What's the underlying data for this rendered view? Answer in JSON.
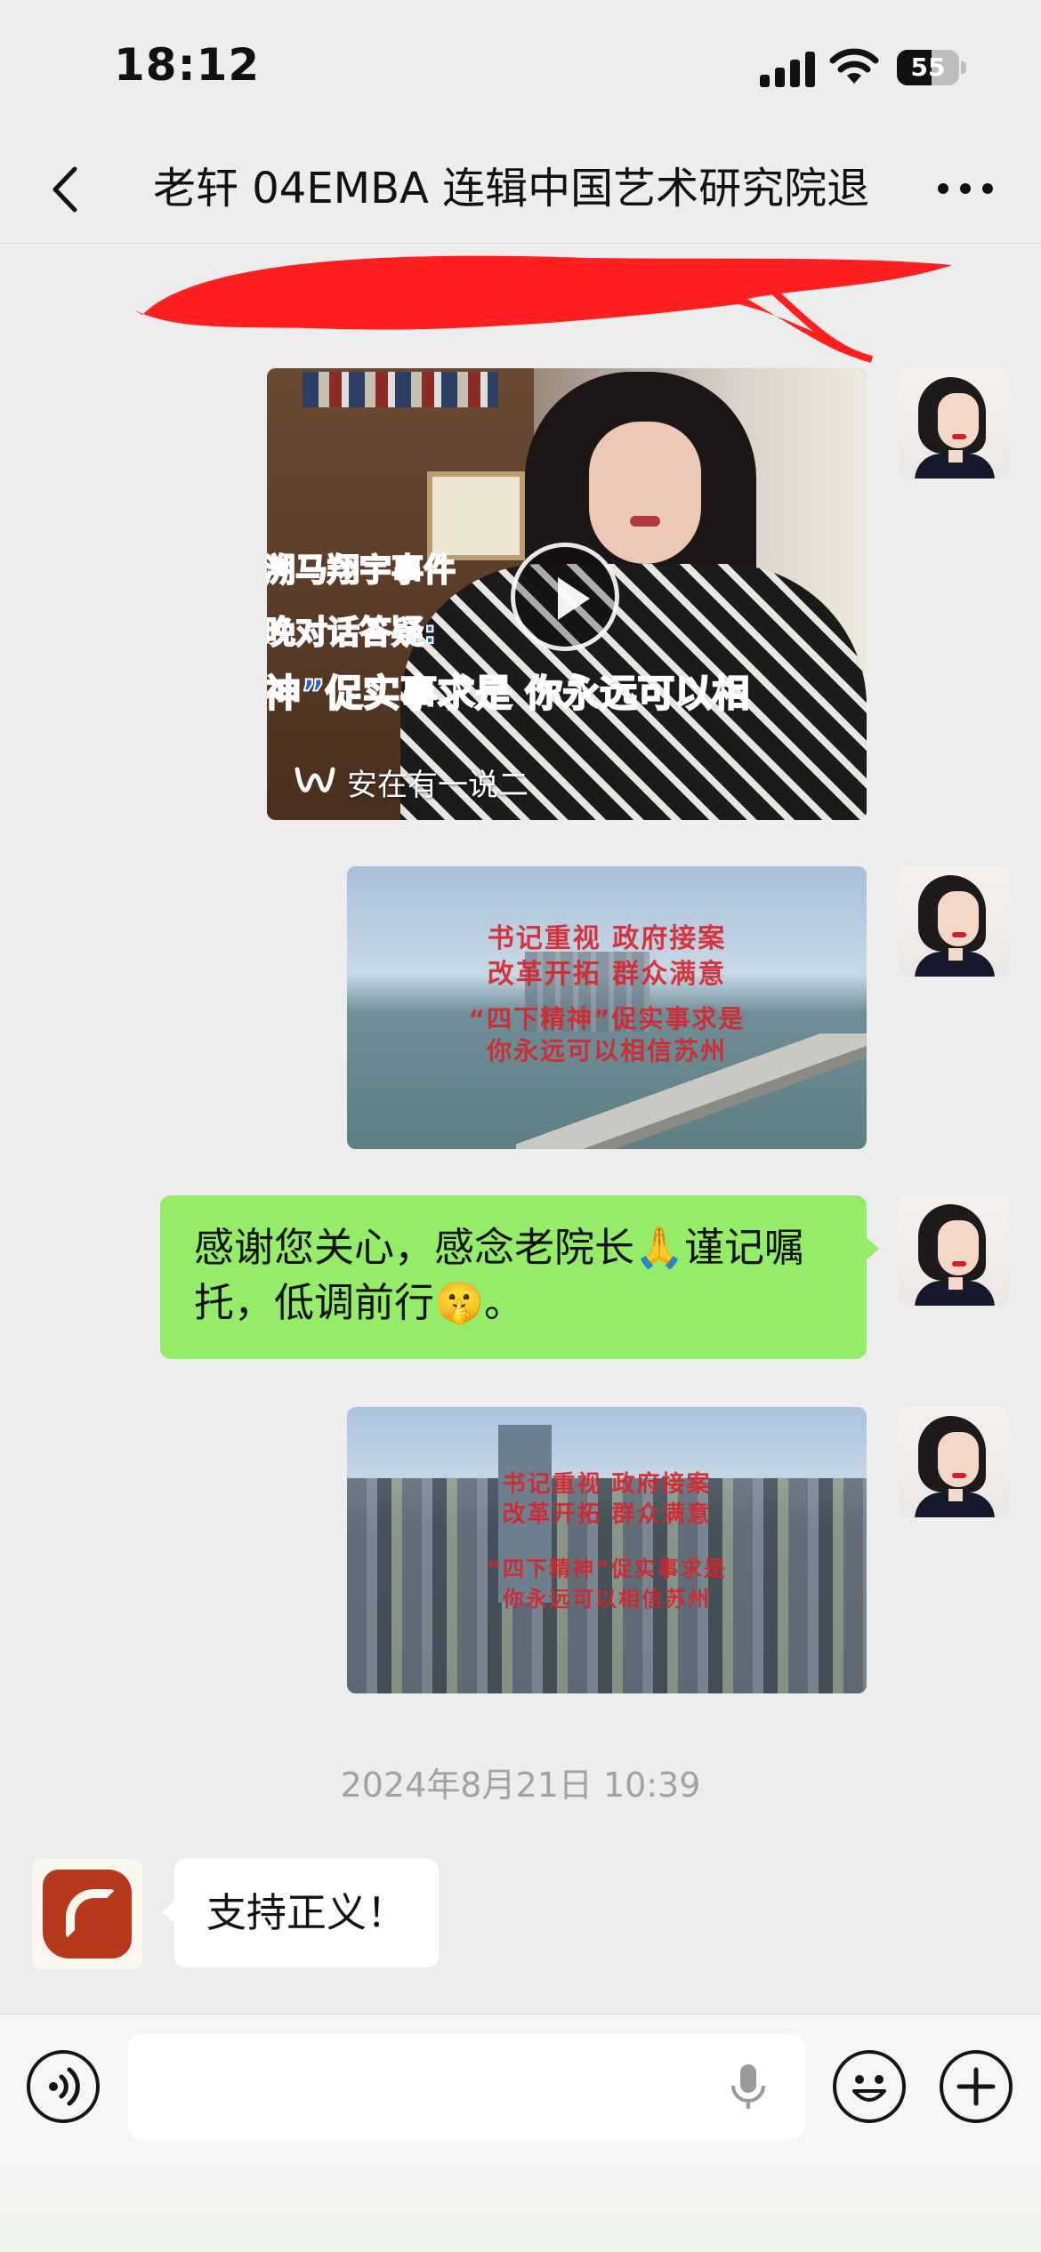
{
  "status_bar": {
    "time": "18:12",
    "battery": "55",
    "battery_level_pct": 55
  },
  "header": {
    "title": "老轩 04EMBA 连辑中国艺术研究院退",
    "back_icon": "chevron-left-icon",
    "more_icon": "ellipsis-icon"
  },
  "messages": {
    "video": {
      "caption_lines": [
        "溯马翔宇事件",
        "晚对话答疑:",
        "神”促实事求是 你永远可以相"
      ],
      "source": "安在有一说二",
      "play_icon": "play-icon"
    },
    "image1": {
      "lines": [
        "书记重视 政府接案",
        "改革开拓 群众满意",
        "“四下精神”促实事求是",
        "你永远可以相信苏州"
      ]
    },
    "text1": "感谢您关心，感念老院长🙏谨记嘱托，低调前行🤫。",
    "image2": {
      "lines": [
        "书记重视 政府接案",
        "改革开拓 群众满意",
        "“四下精神”促实事求是",
        "你永远可以相信苏州"
      ]
    },
    "timestamp": "2024年8月21日 10:39",
    "text2": "支持正义！"
  },
  "input_bar": {
    "placeholder": "",
    "voice_icon": "voice-icon",
    "mic_icon": "microphone-icon",
    "emoji_icon": "emoji-icon",
    "plus_icon": "plus-icon"
  },
  "colors": {
    "self_bubble": "#95ec69",
    "other_bubble": "#ffffff",
    "background": "#ededed",
    "redaction": "#ff0000"
  }
}
